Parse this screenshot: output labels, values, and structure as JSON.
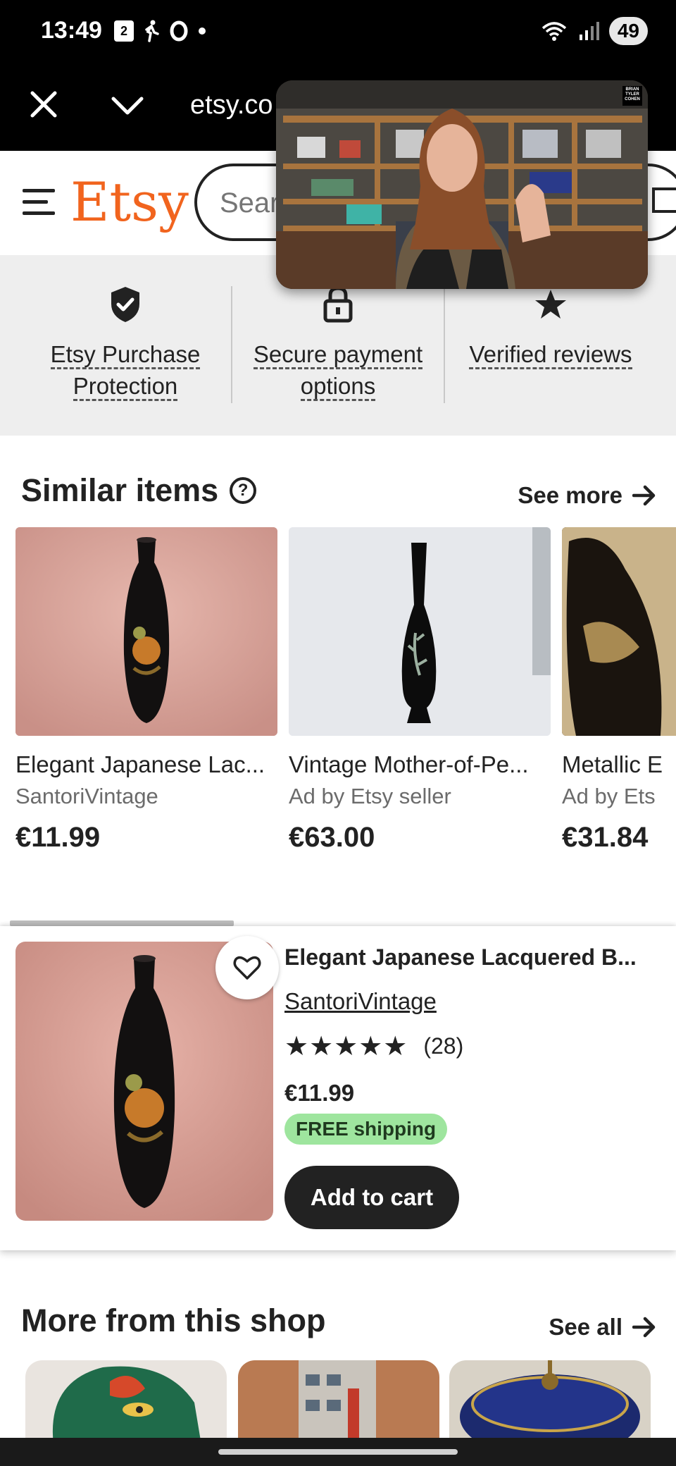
{
  "status_bar": {
    "time": "13:49",
    "calendar_badge": "2",
    "battery": "49"
  },
  "browser": {
    "url": "etsy.co"
  },
  "header": {
    "logo": "Etsy",
    "search_placeholder": "Sear"
  },
  "trust": [
    {
      "icon": "shield-check-icon",
      "label": "Etsy Purchase Protection"
    },
    {
      "icon": "lock-icon",
      "label": "Secure payment options"
    },
    {
      "icon": "star-icon",
      "label": "Verified reviews"
    }
  ],
  "similar": {
    "title": "Similar items",
    "see_more": "See more",
    "items": [
      {
        "title": "Elegant Japanese Lac...",
        "seller": "SantoriVintage",
        "price": "€11.99"
      },
      {
        "title": "Vintage Mother-of-Pe...",
        "seller": "Ad by Etsy seller",
        "price": "€63.00"
      },
      {
        "title": "Metallic E",
        "seller": "Ad by Ets",
        "price": "€31.84"
      }
    ]
  },
  "listing": {
    "title": "Elegant Japanese Lacquered B...",
    "shop": "SantoriVintage",
    "stars": "★★★★★",
    "rating": 5,
    "review_count": "(28)",
    "price": "€11.99",
    "shipping": "FREE shipping",
    "add_to_cart": "Add to cart"
  },
  "more_from_shop": {
    "title": "More from this shop",
    "see_all": "See all"
  },
  "colors": {
    "brand": "#f1641e",
    "free_shipping_bg": "#9ee59e",
    "dark": "#222222"
  }
}
